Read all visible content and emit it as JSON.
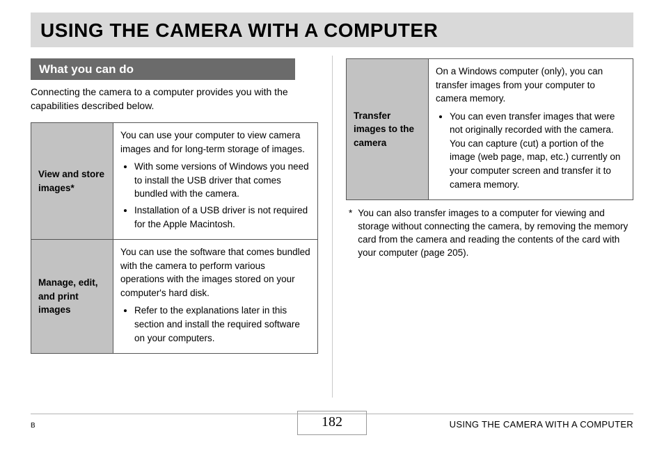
{
  "title": "USING THE CAMERA WITH A COMPUTER",
  "section": {
    "heading": "What you can do",
    "intro": "Connecting the camera to a computer provides you with the capabilities described below."
  },
  "table_left": {
    "row1": {
      "label": "View and store images*",
      "body_intro": "You can use your computer to view camera images and for long-term storage of images.",
      "bullets": [
        "With some versions of Windows you need to install the USB driver that comes bundled with the camera.",
        "Installation of a USB driver is not required for the Apple Macintosh."
      ]
    },
    "row2": {
      "label": "Manage, edit, and print images",
      "body_intro": "You can use the software that comes bundled with the camera to perform various operations with the images stored on your computer's hard disk.",
      "bullets": [
        "Refer to the explanations later in this section and install the required software on your computers."
      ]
    }
  },
  "table_right": {
    "row1": {
      "label": "Transfer images to the camera",
      "body_intro": "On a Windows computer (only), you can transfer images from your computer to camera memory.",
      "bullets": [
        "You can even transfer images that were not originally recorded with the camera. You can capture (cut) a portion of the image (web page, map, etc.) currently on your computer screen and transfer it to camera memory."
      ]
    }
  },
  "footnote": {
    "mark": "*",
    "text": "You can also transfer images to a computer for viewing and storage without connecting the camera, by removing the memory card from the camera and reading the contents of the card with your computer (page 205)."
  },
  "footer": {
    "left_mark": "B",
    "page_number": "182",
    "right_text": "USING THE CAMERA WITH A COMPUTER"
  }
}
